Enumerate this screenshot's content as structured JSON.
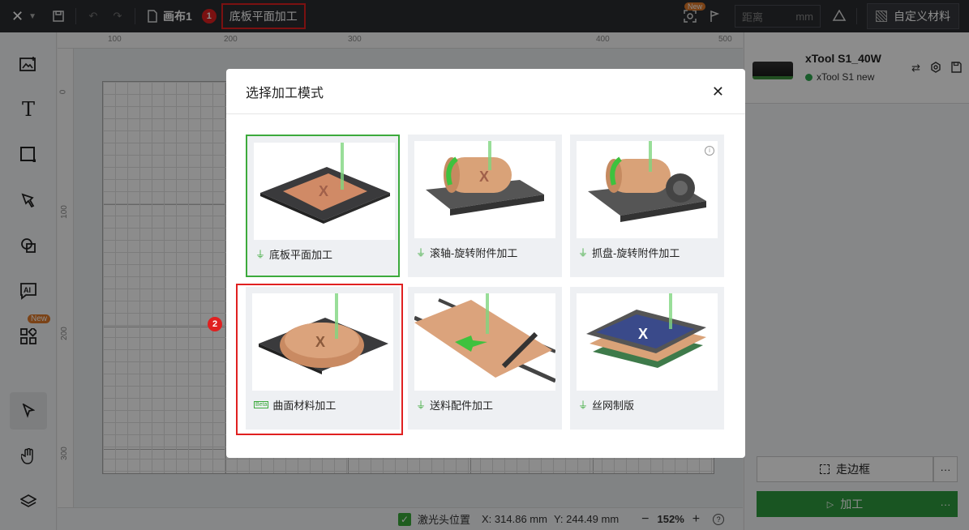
{
  "topbar": {
    "canvas_name": "画布1",
    "mode": "底板平面加工",
    "new_tag": "New",
    "distance_placeholder": "距离",
    "distance_unit": "mm",
    "custom_material": "自定义材料"
  },
  "leftbar": {
    "new_badge": "New"
  },
  "ruler": {
    "x": [
      "100",
      "200",
      "300",
      "400",
      "500"
    ],
    "y": [
      "0",
      "100",
      "200",
      "300"
    ]
  },
  "statusbar": {
    "laser_label": "激光头位置",
    "x": "X: 314.86 mm",
    "y": "Y: 244.49 mm",
    "zoom": "152%"
  },
  "device": {
    "name": "xTool S1_40W",
    "status": "xTool S1 new"
  },
  "actions": {
    "frame": "走边框",
    "process": "加工"
  },
  "modal": {
    "title": "选择加工模式",
    "modes": [
      {
        "label": "底板平面加工"
      },
      {
        "label": "滚轴-旋转附件加工"
      },
      {
        "label": "抓盘-旋转附件加工"
      },
      {
        "label": "曲面材料加工",
        "badge": "Beta"
      },
      {
        "label": "送料配件加工"
      },
      {
        "label": "丝网制版"
      }
    ]
  },
  "annotations": [
    "1",
    "2"
  ],
  "colors": {
    "accent": "#2e9b3e",
    "highlight": "#e02020",
    "brand_orange": "#e07a2a"
  }
}
